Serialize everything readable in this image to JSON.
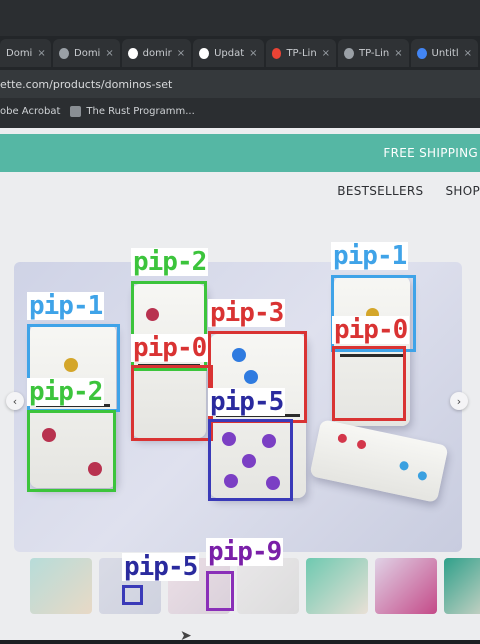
{
  "browser": {
    "tabs": [
      {
        "label": "Domi",
        "icon": "doc-icon",
        "color": "#c9ccd0"
      },
      {
        "label": "Domi",
        "icon": "globe-icon",
        "color": "#9aa0a6"
      },
      {
        "label": "domir",
        "icon": "github-icon",
        "color": "#ffffff"
      },
      {
        "label": "Updat",
        "icon": "github-icon",
        "color": "#ffffff"
      },
      {
        "label": "TP-Lin",
        "icon": "gmail-icon",
        "color": "#ea4335"
      },
      {
        "label": "TP-Lin",
        "icon": "globe-icon",
        "color": "#9aa0a6"
      },
      {
        "label": "Untitl",
        "icon": "docs-icon",
        "color": "#4285f4"
      }
    ],
    "tab_close": "×",
    "url": "ette.com/products/dominos-set",
    "bookmarks": [
      {
        "label": "obe Acrobat",
        "icon": "acrobat-icon"
      },
      {
        "label": "The Rust Programm...",
        "icon": "book-icon"
      }
    ]
  },
  "page": {
    "banner": "FREE SHIPPING",
    "nav": [
      "BESTSELLERS",
      "SHOP"
    ],
    "arrows": {
      "prev": "‹",
      "next": "›"
    }
  },
  "detections": [
    {
      "label": "pip-2",
      "color": "#3cc43c",
      "text_color": "#3cc43c"
    },
    {
      "label": "pip-1",
      "color": "#3fa3e8",
      "text_color": "#3fa3e8"
    },
    {
      "label": "pip-1",
      "color": "#3fa3e8",
      "text_color": "#3fa3e8"
    },
    {
      "label": "pip-3",
      "color": "#d93333",
      "text_color": "#d93333"
    },
    {
      "label": "pip-0",
      "color": "#d93333",
      "text_color": "#d93333"
    },
    {
      "label": "pip-0",
      "color": "#d93333",
      "text_color": "#d93333"
    },
    {
      "label": "pip-2",
      "color": "#3cc43c",
      "text_color": "#3cc43c"
    },
    {
      "label": "pip-5",
      "color": "#3a3ab8",
      "text_color": "#2a2a9e"
    },
    {
      "label": "pip-5",
      "color": "#3a3ab8",
      "text_color": "#2a2a9e"
    },
    {
      "label": "pip-9",
      "color": "#8a2fb8",
      "text_color": "#7a1fa8"
    }
  ],
  "colors": {
    "banner": "#55b7a4",
    "page_bg": "#ecedef",
    "chrome_bg": "#2b2e31"
  }
}
